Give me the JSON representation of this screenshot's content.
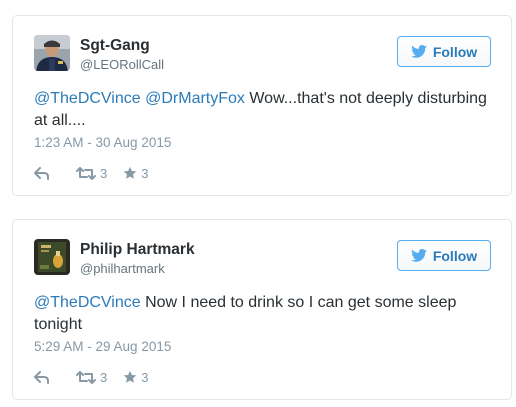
{
  "tweets": [
    {
      "display_name": "Sgt-Gang",
      "handle": "@LEORollCall",
      "avatar_icon": "profile-photo-officer",
      "follow_label": "Follow",
      "text_segments": [
        {
          "text": "@TheDCVince",
          "type": "mention"
        },
        {
          "text": " ",
          "type": "plain"
        },
        {
          "text": "@DrMartyFox",
          "type": "mention"
        },
        {
          "text": " Wow...that's not deeply disturbing at all....",
          "type": "plain"
        }
      ],
      "timestamp": "1:23 AM - 30 Aug 2015",
      "retweets": "3",
      "likes": "3"
    },
    {
      "display_name": "Philip Hartmark",
      "handle": "@philhartmark",
      "avatar_icon": "profile-photo-book-cover",
      "follow_label": "Follow",
      "text_segments": [
        {
          "text": "@TheDCVince",
          "type": "mention"
        },
        {
          "text": " Now I need to drink so I can get some sleep tonight",
          "type": "plain"
        }
      ],
      "timestamp": "5:29 AM - 29 Aug 2015",
      "retweets": "3",
      "likes": "3"
    }
  ],
  "colors": {
    "link": "#2b7bb9",
    "follow_border": "#55acee",
    "muted": "#8899a6",
    "border": "#e1e8ed",
    "text": "#292f33"
  },
  "icons": {
    "follow": "twitter-bird-icon",
    "reply": "reply-arrow-icon",
    "retweet": "retweet-icon",
    "like": "star-icon"
  }
}
